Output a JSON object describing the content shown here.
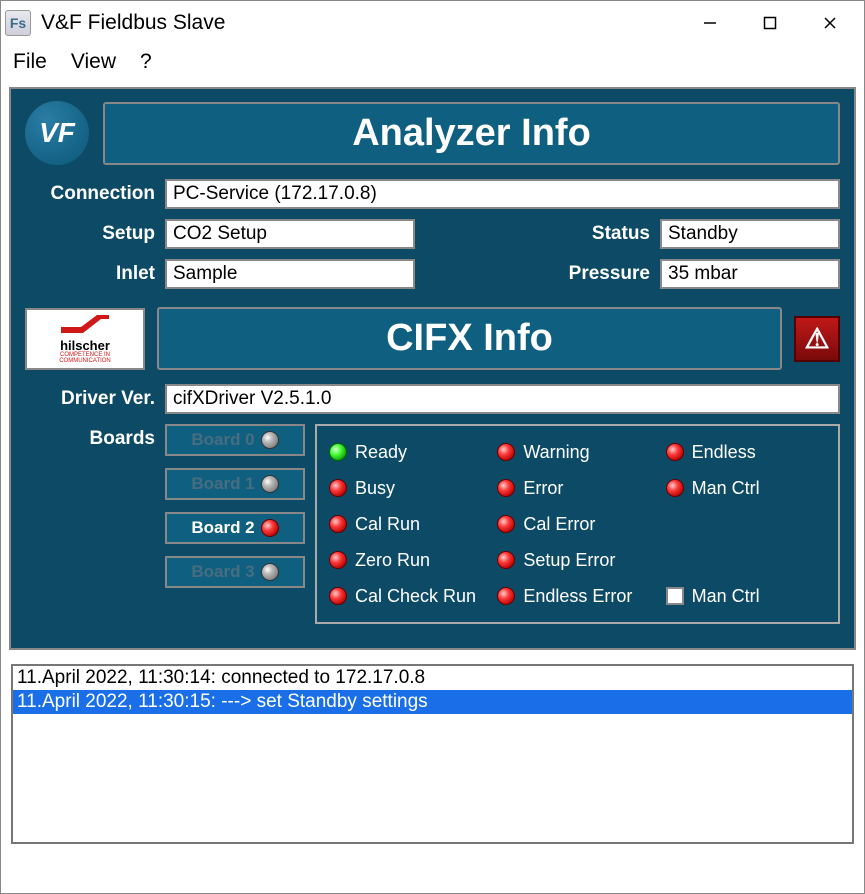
{
  "window": {
    "icon_text": "Fs",
    "title": "V&F Fieldbus Slave"
  },
  "menu": {
    "file": "File",
    "view": "View",
    "help": "?"
  },
  "analyzer": {
    "logo": "VF",
    "title": "Analyzer Info",
    "connection_label": "Connection",
    "connection_value": "PC-Service (172.17.0.8)",
    "setup_label": "Setup",
    "setup_value": "CO2 Setup",
    "status_label": "Status",
    "status_value": "Standby",
    "inlet_label": "Inlet",
    "inlet_value": "Sample",
    "pressure_label": "Pressure",
    "pressure_value": "35 mbar"
  },
  "cifx": {
    "vendor_top": "hilscher",
    "vendor_sub1": "COMPETENCE IN",
    "vendor_sub2": "COMMUNICATION",
    "title": "CIFX Info",
    "alert_glyph": "⚠",
    "driver_label": "Driver Ver.",
    "driver_value": "cifXDriver V2.5.1.0",
    "boards_label": "Boards",
    "boards": [
      {
        "label": "Board 0",
        "active": false,
        "led": "off"
      },
      {
        "label": "Board 1",
        "active": false,
        "led": "off"
      },
      {
        "label": "Board 2",
        "active": true,
        "led": "red"
      },
      {
        "label": "Board 3",
        "active": false,
        "led": "off"
      }
    ],
    "status": {
      "col1": [
        {
          "label": "Ready",
          "led": "green"
        },
        {
          "label": "Busy",
          "led": "red"
        },
        {
          "label": "Cal Run",
          "led": "red"
        },
        {
          "label": "Zero Run",
          "led": "red"
        },
        {
          "label": "Cal Check Run",
          "led": "red"
        }
      ],
      "col2": [
        {
          "label": "Warning",
          "led": "red"
        },
        {
          "label": "Error",
          "led": "red"
        },
        {
          "label": "Cal Error",
          "led": "red"
        },
        {
          "label": "Setup Error",
          "led": "red"
        },
        {
          "label": "Endless Error",
          "led": "red"
        }
      ],
      "col3": [
        {
          "label": "Endless",
          "led": "red",
          "type": "led"
        },
        {
          "label": "Man Ctrl",
          "led": "red",
          "type": "led"
        },
        {
          "label": "",
          "type": "empty"
        },
        {
          "label": "",
          "type": "empty"
        },
        {
          "label": "Man Ctrl",
          "type": "checkbox"
        }
      ]
    }
  },
  "log": [
    {
      "text": "11.April 2022, 11:30:14: connected to 172.17.0.8",
      "selected": false
    },
    {
      "text": "11.April 2022, 11:30:15: ---> set Standby settings",
      "selected": true
    }
  ]
}
